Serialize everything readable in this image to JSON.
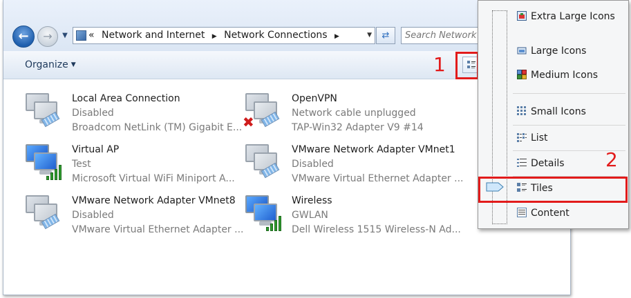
{
  "address_bar": {
    "overflow_chevron": "«",
    "breadcrumbs": [
      "Network and Internet",
      "Network Connections"
    ],
    "search_placeholder": "Search Network C"
  },
  "toolbar": {
    "organize_label": "Organize"
  },
  "annotations": {
    "label_1": "1",
    "label_2": "2"
  },
  "connections": [
    {
      "name": "Local Area Connection",
      "status": "Disabled",
      "device": "Broadcom NetLink (TM) Gigabit E...",
      "icon": "wired-network-icon"
    },
    {
      "name": "OpenVPN",
      "status": "Network cable unplugged",
      "device": "TAP-Win32 Adapter V9 #14",
      "icon": "wired-network-error-icon"
    },
    {
      "name": "Virtual AP",
      "status": "Test",
      "device": "Microsoft Virtual WiFi Miniport A...",
      "icon": "wireless-network-icon"
    },
    {
      "name": "VMware Network Adapter VMnet1",
      "status": "Disabled",
      "device": "VMware Virtual Ethernet Adapter ...",
      "icon": "wired-network-icon"
    },
    {
      "name": "VMware Network Adapter VMnet8",
      "status": "Disabled",
      "device": "VMware Virtual Ethernet Adapter ...",
      "icon": "wired-network-icon"
    },
    {
      "name": "Wireless",
      "status": "GWLAN",
      "device": "Dell Wireless 1515 Wireless-N Ad...",
      "icon": "wireless-network-icon"
    }
  ],
  "view_menu": {
    "items": [
      {
        "label": "Extra Large Icons",
        "icon": "extra-large-icons-icon"
      },
      {
        "label": "Large Icons",
        "icon": "large-icons-icon"
      },
      {
        "label": "Medium Icons",
        "icon": "medium-icons-icon"
      },
      {
        "label": "Small Icons",
        "icon": "small-icons-icon"
      },
      {
        "label": "List",
        "icon": "list-view-icon"
      },
      {
        "label": "Details",
        "icon": "details-view-icon"
      },
      {
        "label": "Tiles",
        "icon": "tiles-view-icon"
      },
      {
        "label": "Content",
        "icon": "content-view-icon"
      }
    ],
    "selected": "Tiles"
  },
  "colors": {
    "annotation_red": "#e21b1b",
    "link_blue": "#1e395b",
    "secondary_text": "#7a7a7a"
  }
}
